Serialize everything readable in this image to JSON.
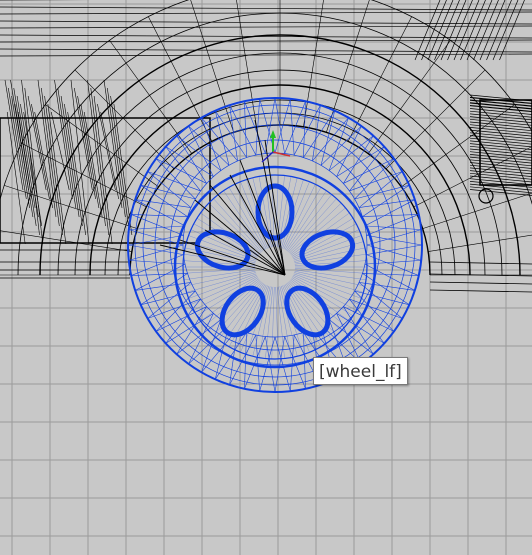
{
  "viewport": {
    "background": "#c8c8c8",
    "grid_color": "#9a9a9a",
    "wire_color": "#000000"
  },
  "selection": {
    "object_name": "[wheel_lf]",
    "wire_color": "#1040e0"
  },
  "gizmo": {
    "y_axis_color": "#22c022",
    "x_axis_color": "#d03030",
    "z_axis_color": "#2020c0"
  }
}
